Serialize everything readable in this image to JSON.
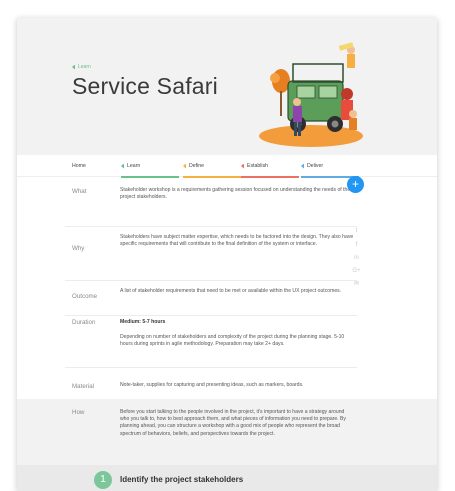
{
  "breadcrumb": {
    "label": "Learn"
  },
  "page_title": "Service Safari",
  "tabs": [
    {
      "label": "Home",
      "color": ""
    },
    {
      "label": "Learn",
      "color": "#6bbf8c"
    },
    {
      "label": "Define",
      "color": "#f5b041"
    },
    {
      "label": "Establish",
      "color": "#ec7063"
    },
    {
      "label": "Deliver",
      "color": "#5dade2"
    }
  ],
  "sections": {
    "what": {
      "label": "What",
      "text": "Stakeholder workshop is a requirements gathering session focused on understanding the needs of the project stakeholders."
    },
    "why": {
      "label": "Why",
      "text": "Stakeholders have subject matter expertise, which needs to be factored into the design. They also have specific requirements that will contribute to the final definition of the system or interface."
    },
    "outcome": {
      "label": "Outcome",
      "text": "A list of stakeholder requirements that need to be met or available within the UX project outcomes."
    },
    "duration": {
      "label": "Duration",
      "headline": "Medium: 5-7 hours",
      "text": "Depending on number of stakeholders and complexity of the project during the planning stage. 5-10 hours during sprints in agile methodology. Preparation may take 2+ days."
    },
    "material": {
      "label": "Material",
      "text": "Note-taker, supplies for capturing and presenting ideas, such as markers, boards."
    },
    "how": {
      "label": "How",
      "text": "Before you start talking to the people involved in the project, it's important to have a strategy around who you talk to, how to best approach them, and what pieces of information you need to prepare. By planning ahead, you can structure a workshop with a good mix of people who represent the broad spectrum of behaviors, beliefs, and perspectives towards the project."
    }
  },
  "step": {
    "number": "1",
    "title": "Identify the project stakeholders"
  },
  "fab": {
    "label": "+",
    "color": "#2196f3"
  },
  "share_icons": [
    "twitter-icon",
    "facebook-icon",
    "linkedin-icon",
    "google-plus-icon",
    "mail-icon"
  ],
  "share_glyphs": [
    "t",
    "f",
    "in",
    "G+",
    "✉"
  ]
}
